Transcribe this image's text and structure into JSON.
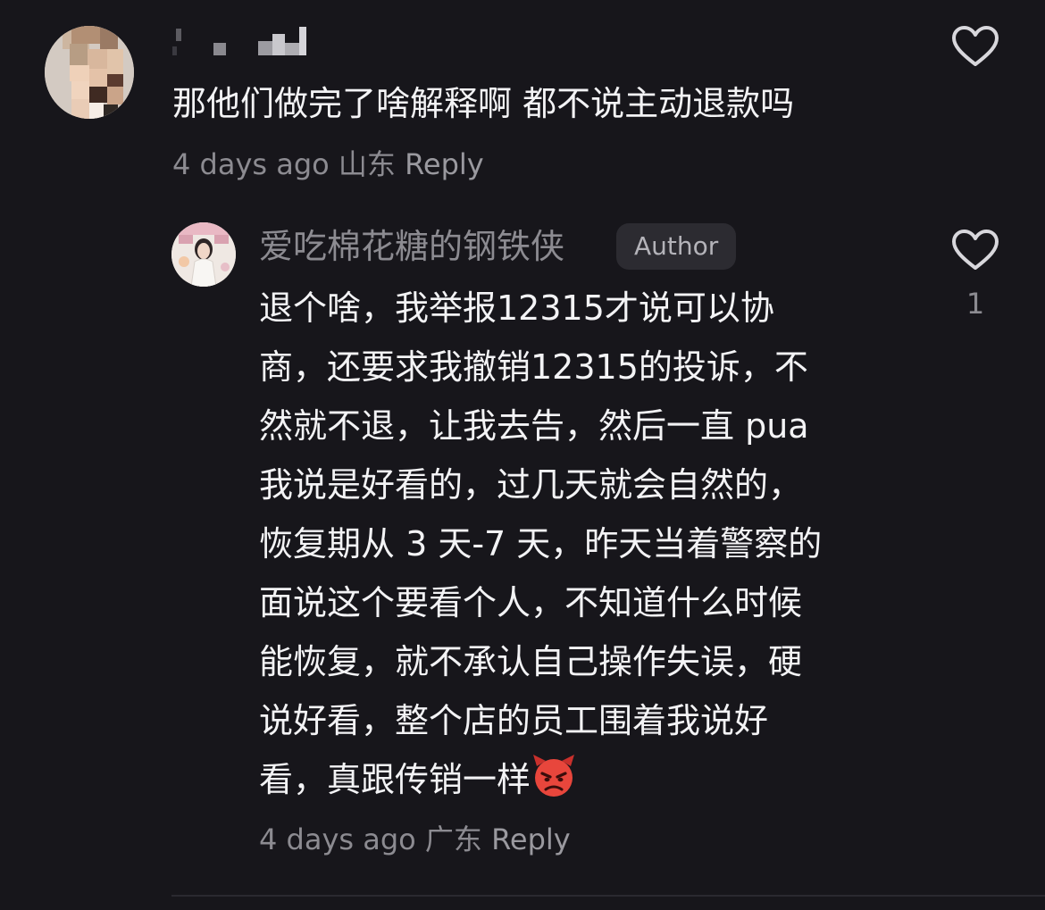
{
  "comment": {
    "text": "那他们做完了啥解释啊 都不说主动退款吗",
    "time": "4 days ago",
    "location": "山东",
    "reply_label": "Reply"
  },
  "reply": {
    "author": "爱吃棉花糖的钢铁侠",
    "badge": "Author",
    "lines": [
      "退个啥，我举报12315才说可以协",
      "商，还要求我撤销12315的投诉，不",
      "然就不退，让我去告，然后一直 pua",
      "我说是好看的，过几天就会自然的，",
      "恢复期从 3 天-7 天，昨天当着警察的",
      "面说这个要看个人，不知道什么时候",
      "能恢复，就不承认自己操作失误，硬",
      "说好看，整个店的员工围着我说好",
      "看，真跟传销一样"
    ],
    "emoji": "angry-devil",
    "time": "4 days ago",
    "location": "广东",
    "reply_label": "Reply",
    "like_count": "1"
  },
  "colors": {
    "background": "#17161b",
    "primary_text": "#f3f3f5",
    "secondary_text": "#8c8b91",
    "badge_bg": "#2c2b31",
    "emoji_red": "#e8463c"
  }
}
